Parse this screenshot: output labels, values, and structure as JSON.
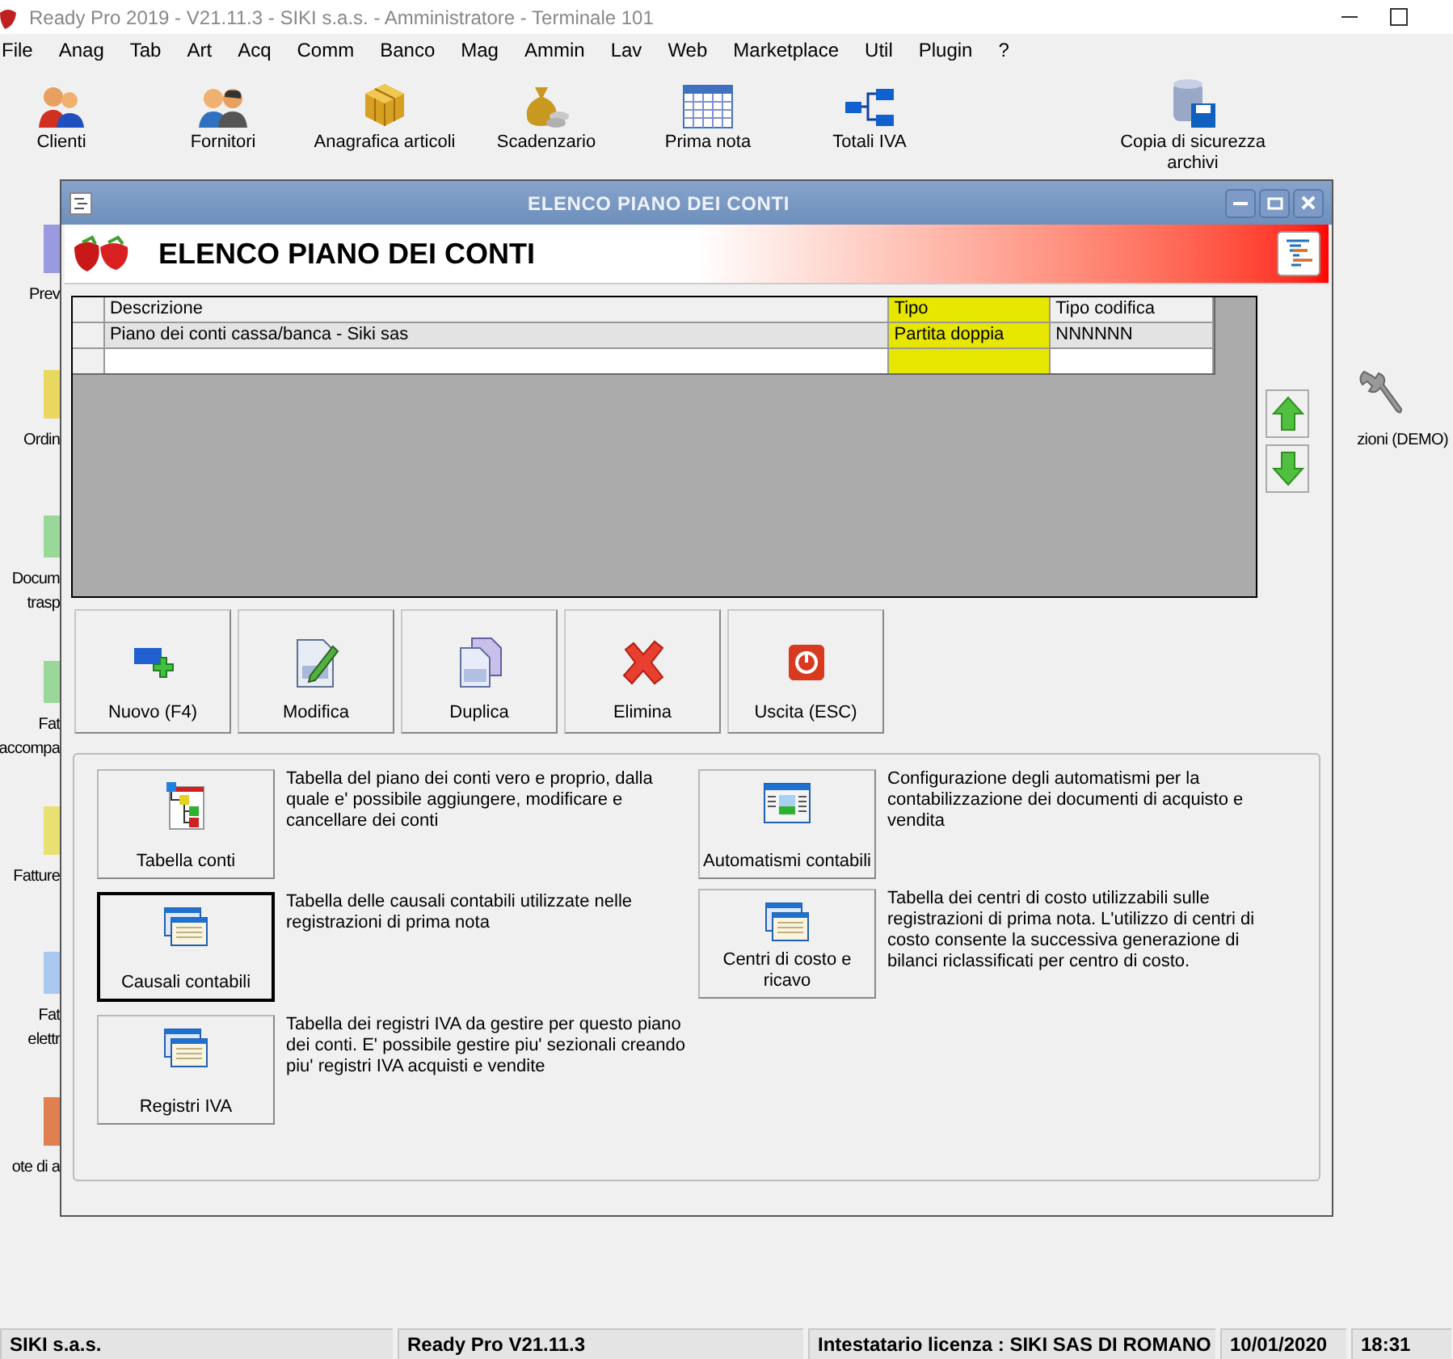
{
  "app_title": "Ready Pro 2019 - V21.11.3 - SIKI s.a.s. - Amministratore - Terminale 101",
  "menu": [
    "File",
    "Anag",
    "Tab",
    "Art",
    "Acq",
    "Comm",
    "Banco",
    "Mag",
    "Ammin",
    "Lav",
    "Web",
    "Marketplace",
    "Util",
    "Plugin",
    "?"
  ],
  "toolbar": [
    {
      "label": "Clienti",
      "kind": "people"
    },
    {
      "label": "Fornitori",
      "kind": "business"
    },
    {
      "label": "Anagrafica articoli",
      "kind": "boxes"
    },
    {
      "label": "Scadenzario",
      "kind": "money"
    },
    {
      "label": "Prima nota",
      "kind": "calendar"
    },
    {
      "label": "Totali IVA",
      "kind": "diagram"
    },
    {
      "label": "Copia di sicurezza archivi",
      "kind": "backup"
    }
  ],
  "left_launchers": [
    {
      "lines": [
        "Prev"
      ],
      "color": "#9a9ae0"
    },
    {
      "lines": [
        "Ordin"
      ],
      "color": "#e8d860"
    },
    {
      "lines": [
        "Docum",
        "trasp"
      ],
      "color": "#9ad89a"
    },
    {
      "lines": [
        "Fat",
        "accompa"
      ],
      "color": "#9ad89a"
    },
    {
      "lines": [
        "Fatture"
      ],
      "color": "#e8e070"
    },
    {
      "lines": [
        "Fat",
        "elettr"
      ],
      "color": "#a8c8f0"
    },
    {
      "lines": [
        "ote di a"
      ],
      "color": "#e08050"
    }
  ],
  "right_launcher": {
    "label": "zioni (DEMO)"
  },
  "dialog": {
    "title": "ELENCO PIANO DEI CONTI",
    "heading": "ELENCO PIANO DEI CONTI",
    "table": {
      "columns": [
        {
          "label": "Descrizione",
          "highlighted": false
        },
        {
          "label": "Tipo",
          "highlighted": true
        },
        {
          "label": "Tipo codifica",
          "highlighted": false
        }
      ],
      "rows": [
        {
          "cells": [
            "Piano dei conti cassa/banca - Siki sas",
            "Partita doppia",
            "NNNNNN"
          ],
          "selected": true
        }
      ]
    },
    "actions": [
      {
        "label": "Nuovo (F4)",
        "kind": "new"
      },
      {
        "label": "Modifica",
        "kind": "edit"
      },
      {
        "label": "Duplica",
        "kind": "copy"
      },
      {
        "label": "Elimina",
        "kind": "delete"
      },
      {
        "label": "Uscita (ESC)",
        "kind": "exit"
      }
    ],
    "functions_left": [
      {
        "label": "Tabella conti",
        "kind": "tree",
        "focused": false,
        "description": "Tabella del piano dei conti vero e proprio, dalla quale e' possibile aggiungere, modificare e cancellare dei conti"
      },
      {
        "label": "Causali contabili",
        "kind": "windows",
        "focused": true,
        "description": "Tabella delle causali contabili utilizzate nelle registrazioni di prima nota"
      },
      {
        "label": "Registri IVA",
        "kind": "windows",
        "focused": false,
        "description": "Tabella dei registri IVA da gestire per questo piano dei conti. E' possibile gestire piu' sezionali creando piu' registri IVA acquisti e vendite"
      }
    ],
    "functions_right": [
      {
        "label": "Automatismi contabili",
        "kind": "form",
        "focused": false,
        "description": "Configurazione degli automatismi per la contabilizzazione dei documenti di acquisto e vendita"
      },
      {
        "label": "Centri di costo e ricavo",
        "kind": "windows",
        "focused": false,
        "description": "Tabella dei centri di costo utilizzabili sulle registrazioni di prima nota. L'utilizzo di centri di costo consente la successiva generazione di bilanci riclassificati per centro di costo."
      }
    ]
  },
  "status_bar": [
    "SIKI s.a.s.",
    "Ready Pro V21.11.3",
    "Intestatario licenza : SIKI SAS DI ROMANO",
    "10/01/2020",
    "18:31"
  ]
}
